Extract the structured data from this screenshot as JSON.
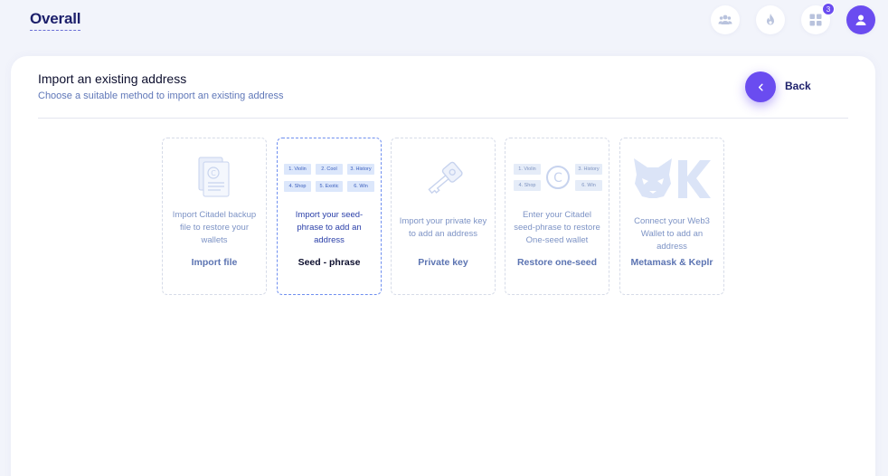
{
  "header": {
    "title": "Overall",
    "notification_count": "3",
    "icons": [
      "users-icon",
      "fire-icon",
      "apps-icon",
      "user-icon"
    ]
  },
  "page": {
    "title": "Import an existing address",
    "subtitle": "Choose a suitable method to import an existing address",
    "back_label": "Back"
  },
  "options": [
    {
      "description": "Import Citadel backup file to restore your wallets",
      "label": "Import file",
      "icon": "document-icon",
      "active": false
    },
    {
      "description": "Import your seed-phrase to add an address",
      "label": "Seed - phrase",
      "icon": "seed-phrase-icon",
      "active": true,
      "chips": [
        "1. Violin",
        "2. Cool",
        "3. History",
        "4. Shop",
        "5. Exotic",
        "6. Win"
      ]
    },
    {
      "description": "Import your private key to add an address",
      "label": "Private key",
      "icon": "key-icon",
      "active": false
    },
    {
      "description": "Enter your Citadel seed-phrase to restore One-seed wallet",
      "label": "Restore one-seed",
      "icon": "one-seed-icon",
      "active": false,
      "chips": [
        "1. Violin",
        "3. History",
        "4. Shop",
        "6. Win"
      ]
    },
    {
      "description": "Connect your Web3 Wallet to add an address",
      "label": "Metamask & Keplr",
      "icon": "metamask-keplr-icon",
      "active": false
    }
  ],
  "colors": {
    "accent": "#6a4cf0",
    "brand_text": "#1c1f6b",
    "muted_text": "#7d93c5",
    "background": "#f2f4fb"
  }
}
